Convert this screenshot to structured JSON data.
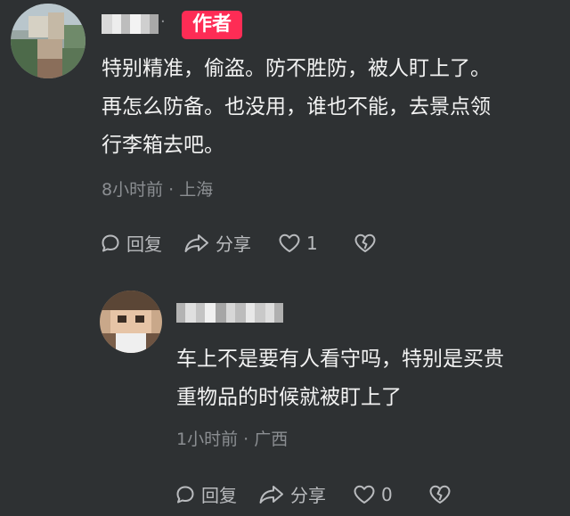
{
  "comment1": {
    "author_tag": "作者",
    "separator": "·",
    "text_lines": [
      "特别精准，偷盗。防不胜防，被人盯上了。",
      "再怎么防备。也没用，谁也不能，去景点领",
      "行李箱去吧。"
    ],
    "meta": "8小时前 · 上海",
    "reply_label": "回复",
    "share_label": "分享",
    "like_count": "1"
  },
  "comment2": {
    "text_lines": [
      "车上不是要有人看守吗，特别是买贵",
      "重物品的时候就被盯上了"
    ],
    "meta": "1小时前 · 广西",
    "reply_label": "回复",
    "share_label": "分享",
    "like_count": "0"
  },
  "colors": {
    "background": "#2e3133",
    "author_tag": "#fe2c55",
    "meta_text": "#8b8e92"
  },
  "icons": [
    "reply-icon",
    "share-icon",
    "heart-icon",
    "broken-heart-icon"
  ]
}
